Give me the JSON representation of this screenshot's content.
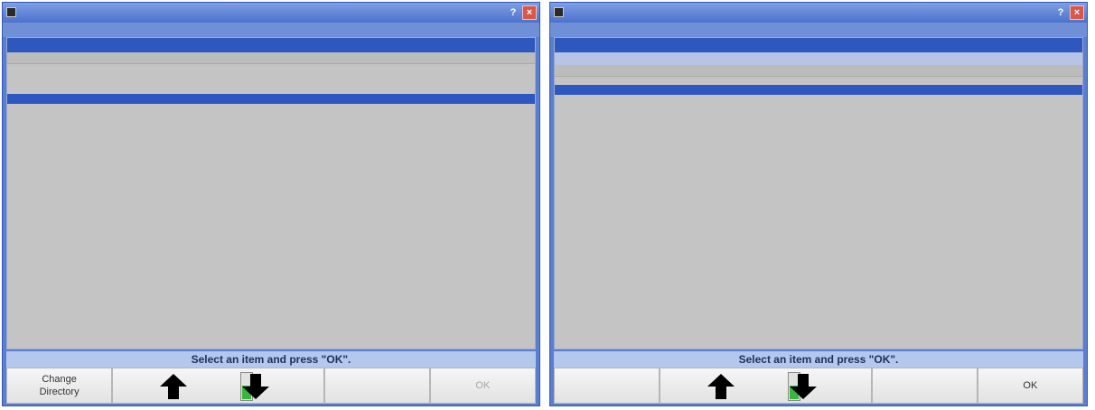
{
  "left_window": {
    "title": "",
    "subtitle": "",
    "panel_header": "",
    "rows": [
      {
        "name": "",
        "size": "",
        "selected": false
      },
      {
        "name": "",
        "size": "",
        "selected": false
      },
      {
        "name": "",
        "size": "",
        "selected": false
      },
      {
        "name": "",
        "size": "",
        "selected": false
      },
      {
        "name": "",
        "size": "",
        "selected": true
      },
      {
        "name": "",
        "size": "",
        "selected": false
      },
      {
        "name": "",
        "size": "",
        "selected": false
      }
    ],
    "status": "Select an item and press \"OK\".",
    "buttons": {
      "change_directory": "Change\nDirectory",
      "ok": "OK",
      "ok_enabled": false
    },
    "battery_level": 0.5
  },
  "right_window": {
    "title": "",
    "subtitle": "",
    "panel_header": "",
    "path_label": "",
    "path_value": "",
    "rows": [
      {
        "name": "",
        "size": "",
        "selected": false
      },
      {
        "name": "",
        "size": "",
        "selected": true
      },
      {
        "name": "",
        "size": "",
        "selected": false
      }
    ],
    "status": "Select an item and press \"OK\".",
    "buttons": {
      "ok": "OK",
      "ok_enabled": true
    },
    "battery_level": 0.5
  },
  "colors": {
    "window_frame": "#5a7fcf",
    "selection": "#2e58c0",
    "panel_background": "#c4c4c4",
    "battery_fill": "#38b83a"
  },
  "icons": {
    "up": "up-arrow-icon",
    "down": "down-arrow-icon",
    "battery": "battery-icon",
    "close": "close-icon",
    "help": "help-icon"
  }
}
